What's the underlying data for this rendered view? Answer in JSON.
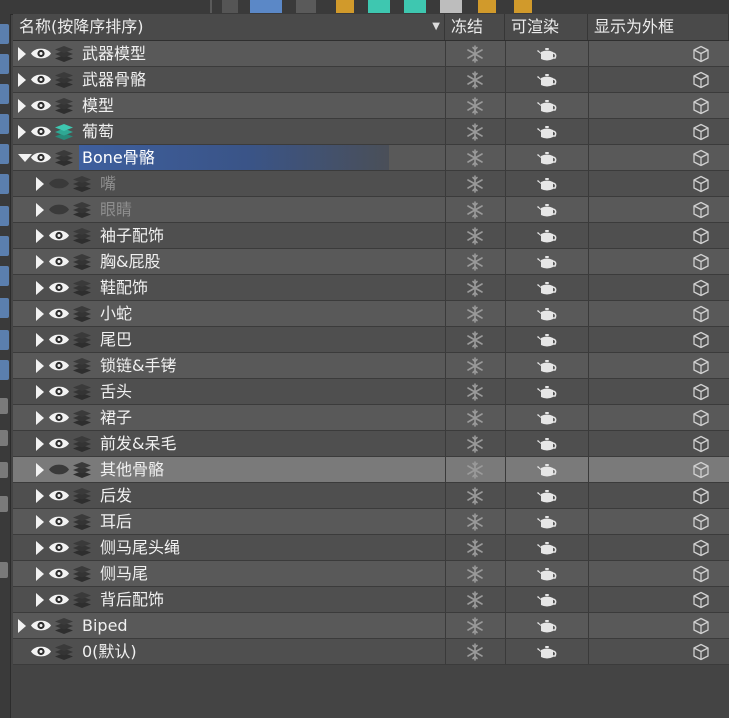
{
  "header": {
    "name_col": "名称(按降序排序)",
    "freeze_col": "冻结",
    "render_col": "可渲染",
    "box_col": "显示为外框"
  },
  "icons": {
    "visible": "eye-icon",
    "hidden": "eye-closed-icon",
    "layer": "layer-stack-icon",
    "layer_active": "layer-stack-active-icon",
    "freeze": "snowflake-icon",
    "render": "teapot-icon",
    "box": "box-cube-icon"
  },
  "colors": {
    "selection": "#3e5f9e",
    "active_layer": "#3ec7b0",
    "highlight_row": "#7a7a7a"
  },
  "layers": [
    {
      "label": "武器模型",
      "depth": 0,
      "expander": "closed",
      "visible": true,
      "active": false,
      "selected": false,
      "dim": false,
      "highlight": false
    },
    {
      "label": "武器骨骼",
      "depth": 0,
      "expander": "closed",
      "visible": true,
      "active": false,
      "selected": false,
      "dim": false,
      "highlight": false
    },
    {
      "label": "模型",
      "depth": 0,
      "expander": "closed",
      "visible": true,
      "active": false,
      "selected": false,
      "dim": false,
      "highlight": false
    },
    {
      "label": "葡萄",
      "depth": 0,
      "expander": "closed",
      "visible": true,
      "active": true,
      "selected": false,
      "dim": false,
      "highlight": false
    },
    {
      "label": "Bone骨骼",
      "depth": 0,
      "expander": "open",
      "visible": true,
      "active": false,
      "selected": true,
      "dim": false,
      "highlight": false
    },
    {
      "label": "嘴",
      "depth": 1,
      "expander": "closed",
      "visible": false,
      "active": false,
      "selected": false,
      "dim": true,
      "highlight": false
    },
    {
      "label": "眼睛",
      "depth": 1,
      "expander": "closed",
      "visible": false,
      "active": false,
      "selected": false,
      "dim": true,
      "highlight": false
    },
    {
      "label": "袖子配饰",
      "depth": 1,
      "expander": "closed",
      "visible": true,
      "active": false,
      "selected": false,
      "dim": false,
      "highlight": false
    },
    {
      "label": "胸&屁股",
      "depth": 1,
      "expander": "closed",
      "visible": true,
      "active": false,
      "selected": false,
      "dim": false,
      "highlight": false
    },
    {
      "label": "鞋配饰",
      "depth": 1,
      "expander": "closed",
      "visible": true,
      "active": false,
      "selected": false,
      "dim": false,
      "highlight": false
    },
    {
      "label": "小蛇",
      "depth": 1,
      "expander": "closed",
      "visible": true,
      "active": false,
      "selected": false,
      "dim": false,
      "highlight": false
    },
    {
      "label": "尾巴",
      "depth": 1,
      "expander": "closed",
      "visible": true,
      "active": false,
      "selected": false,
      "dim": false,
      "highlight": false
    },
    {
      "label": "锁链&手铐",
      "depth": 1,
      "expander": "closed",
      "visible": true,
      "active": false,
      "selected": false,
      "dim": false,
      "highlight": false
    },
    {
      "label": "舌头",
      "depth": 1,
      "expander": "closed",
      "visible": true,
      "active": false,
      "selected": false,
      "dim": false,
      "highlight": false
    },
    {
      "label": "裙子",
      "depth": 1,
      "expander": "closed",
      "visible": true,
      "active": false,
      "selected": false,
      "dim": false,
      "highlight": false
    },
    {
      "label": "前发&呆毛",
      "depth": 1,
      "expander": "closed",
      "visible": true,
      "active": false,
      "selected": false,
      "dim": false,
      "highlight": false
    },
    {
      "label": "其他骨骼",
      "depth": 1,
      "expander": "closed",
      "visible": false,
      "active": false,
      "selected": false,
      "dim": false,
      "highlight": true
    },
    {
      "label": "后发",
      "depth": 1,
      "expander": "closed",
      "visible": true,
      "active": false,
      "selected": false,
      "dim": false,
      "highlight": false
    },
    {
      "label": "耳后",
      "depth": 1,
      "expander": "closed",
      "visible": true,
      "active": false,
      "selected": false,
      "dim": false,
      "highlight": false
    },
    {
      "label": "侧马尾头绳",
      "depth": 1,
      "expander": "closed",
      "visible": true,
      "active": false,
      "selected": false,
      "dim": false,
      "highlight": false
    },
    {
      "label": "侧马尾",
      "depth": 1,
      "expander": "closed",
      "visible": true,
      "active": false,
      "selected": false,
      "dim": false,
      "highlight": false
    },
    {
      "label": "背后配饰",
      "depth": 1,
      "expander": "closed",
      "visible": true,
      "active": false,
      "selected": false,
      "dim": false,
      "highlight": false
    },
    {
      "label": "Biped",
      "depth": 0,
      "expander": "closed",
      "visible": true,
      "active": false,
      "selected": false,
      "dim": false,
      "highlight": false
    },
    {
      "label": "0(默认)",
      "depth": 0,
      "expander": "none",
      "visible": true,
      "active": false,
      "selected": false,
      "dim": false,
      "highlight": false
    }
  ]
}
